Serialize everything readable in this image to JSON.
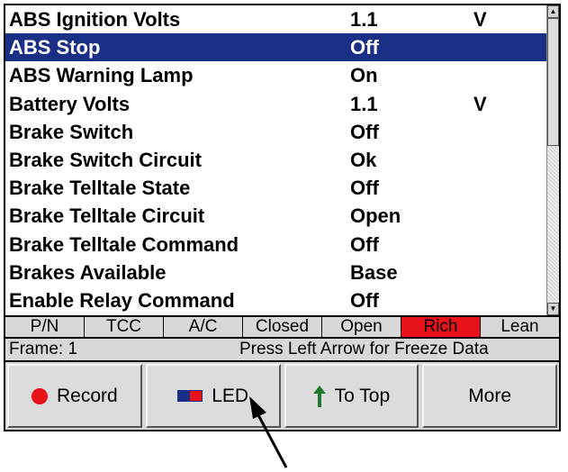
{
  "params": [
    {
      "name": "ABS Ignition Volts",
      "value": "1.1",
      "unit": "V"
    },
    {
      "name": "ABS Stop",
      "value": "Off",
      "unit": ""
    },
    {
      "name": "ABS Warning Lamp",
      "value": "On",
      "unit": ""
    },
    {
      "name": "Battery Volts",
      "value": "1.1",
      "unit": "V"
    },
    {
      "name": "Brake Switch",
      "value": "Off",
      "unit": ""
    },
    {
      "name": "Brake Switch Circuit",
      "value": "Ok",
      "unit": ""
    },
    {
      "name": "Brake Telltale State",
      "value": "Off",
      "unit": ""
    },
    {
      "name": "Brake Telltale Circuit",
      "value": "Open",
      "unit": ""
    },
    {
      "name": "Brake Telltale Command",
      "value": "Off",
      "unit": ""
    },
    {
      "name": "Brakes Available",
      "value": "Base",
      "unit": ""
    },
    {
      "name": "Enable Relay Command",
      "value": "Off",
      "unit": ""
    }
  ],
  "selected_index": 1,
  "status_cells": [
    {
      "label": "P/N",
      "active": false
    },
    {
      "label": "TCC",
      "active": false
    },
    {
      "label": "A/C",
      "active": false
    },
    {
      "label": "Closed",
      "active": false
    },
    {
      "label": "Open",
      "active": false
    },
    {
      "label": "Rich",
      "active": true
    },
    {
      "label": "Lean",
      "active": false
    }
  ],
  "info": {
    "frame": "Frame: 1",
    "hint": "Press Left Arrow for Freeze Data"
  },
  "toolbar": {
    "record_label": "Record",
    "led_label": "LED",
    "top_label": "To Top",
    "more_label": "More"
  },
  "colors": {
    "selection": "#1a2f86",
    "active_status": "#e8121b",
    "record_dot": "#e8121b",
    "arrow_green": "#1f7a2e"
  },
  "icons": {
    "record": "record-icon",
    "led": "led-icon",
    "to_top": "up-arrow-icon"
  }
}
